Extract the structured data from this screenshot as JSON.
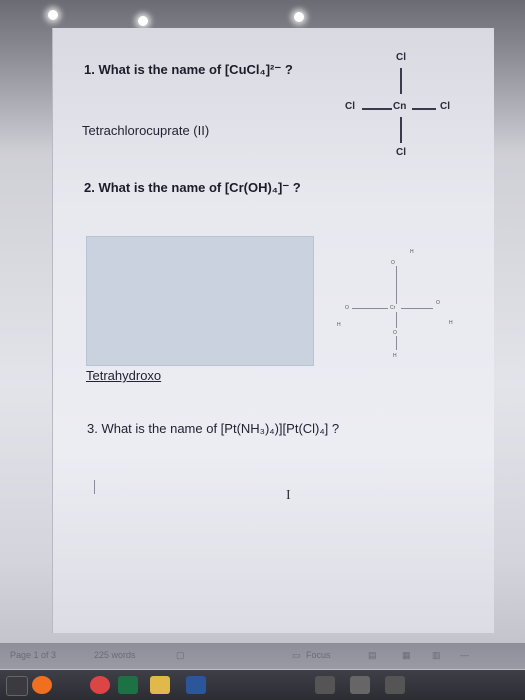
{
  "document": {
    "q1": "1. What is the name of [CuCl₄]²⁻ ?",
    "a1": "Tetrachlorocuprate (II)",
    "q2": "2. What is the name of [Cr(OH)₄]⁻ ?",
    "a2": "Tetrahydroxo",
    "q3": "3. What is the name of [Pt(NH₃)₄)][Pt(Cl)₄] ?"
  },
  "structure1": {
    "top": "Cl",
    "left": "Cl",
    "center": "Cn",
    "right": "Cl",
    "bottom": "Cl"
  },
  "structure2": {
    "top_o": "O",
    "top_h": "H",
    "left_o": "O",
    "left_h": "H",
    "center": "Cr",
    "right_o": "O",
    "right_h": "H",
    "bottom_o": "O",
    "bottom_h": "H"
  },
  "status": {
    "page": "Page 1 of 3",
    "words": "225 words",
    "focus": "Focus"
  },
  "taskbar_icons": [
    "windows-icon",
    "search-icon",
    "chrome-icon",
    "excel-icon",
    "file-explorer-icon",
    "word-icon"
  ]
}
